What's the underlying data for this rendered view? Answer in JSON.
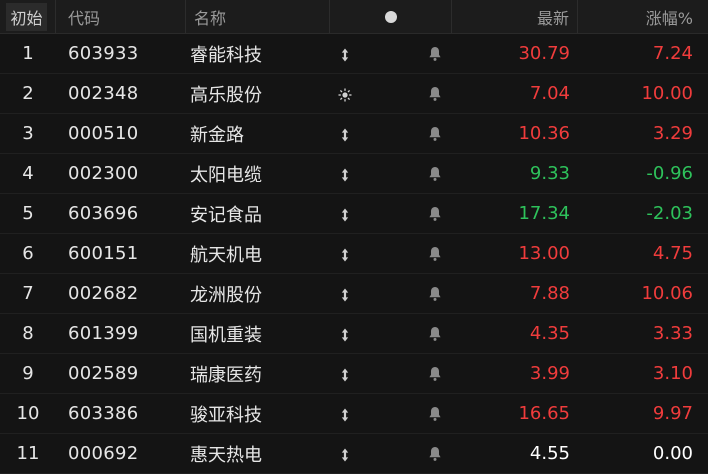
{
  "header": {
    "rank_label": "初始",
    "code_label": "代码",
    "name_label": "名称",
    "price_label": "最新",
    "change_label": "涨幅%"
  },
  "colors": {
    "up": "#f03c3c",
    "down": "#2ec25b",
    "flat": "#ffffff"
  },
  "rows": [
    {
      "rank": "1",
      "code": "603933",
      "name": "睿能科技",
      "icon": "up-down-arrows-icon",
      "price": "30.79",
      "change": "7.24",
      "price_color": "red",
      "change_color": "red"
    },
    {
      "rank": "2",
      "code": "002348",
      "name": "高乐股份",
      "icon": "sun-icon",
      "price": "7.04",
      "change": "10.00",
      "price_color": "red",
      "change_color": "red"
    },
    {
      "rank": "3",
      "code": "000510",
      "name": "新金路",
      "icon": "up-down-arrows-icon",
      "price": "10.36",
      "change": "3.29",
      "price_color": "red",
      "change_color": "red"
    },
    {
      "rank": "4",
      "code": "002300",
      "name": "太阳电缆",
      "icon": "up-down-arrows-icon",
      "price": "9.33",
      "change": "-0.96",
      "price_color": "green",
      "change_color": "green"
    },
    {
      "rank": "5",
      "code": "603696",
      "name": "安记食品",
      "icon": "up-down-arrows-icon",
      "price": "17.34",
      "change": "-2.03",
      "price_color": "green",
      "change_color": "green"
    },
    {
      "rank": "6",
      "code": "600151",
      "name": "航天机电",
      "icon": "up-down-arrows-icon",
      "price": "13.00",
      "change": "4.75",
      "price_color": "red",
      "change_color": "red"
    },
    {
      "rank": "7",
      "code": "002682",
      "name": "龙洲股份",
      "icon": "up-down-arrows-icon",
      "price": "7.88",
      "change": "10.06",
      "price_color": "red",
      "change_color": "red"
    },
    {
      "rank": "8",
      "code": "601399",
      "name": "国机重装",
      "icon": "up-down-arrows-icon",
      "price": "4.35",
      "change": "3.33",
      "price_color": "red",
      "change_color": "red"
    },
    {
      "rank": "9",
      "code": "002589",
      "name": "瑞康医药",
      "icon": "up-down-arrows-icon",
      "price": "3.99",
      "change": "3.10",
      "price_color": "red",
      "change_color": "red"
    },
    {
      "rank": "10",
      "code": "603386",
      "name": "骏亚科技",
      "icon": "up-down-arrows-icon",
      "price": "16.65",
      "change": "9.97",
      "price_color": "red",
      "change_color": "red"
    },
    {
      "rank": "11",
      "code": "000692",
      "name": "惠天热电",
      "icon": "up-down-arrows-icon",
      "price": "4.55",
      "change": "0.00",
      "price_color": "white",
      "change_color": "white"
    }
  ]
}
